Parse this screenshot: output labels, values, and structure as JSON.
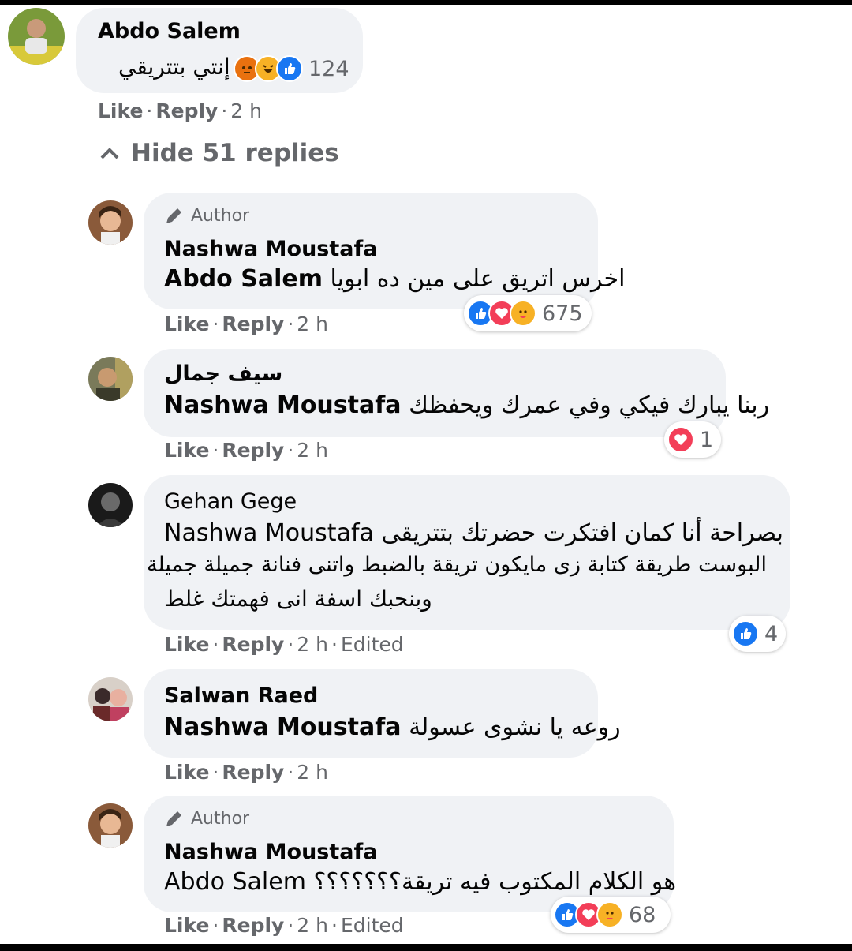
{
  "colors": {
    "like_blue": "#1877f2",
    "love_red": "#f33e58",
    "haha_yellow": "#f7b125",
    "text_grey": "#65676b",
    "bubble_bg": "#f0f2f5"
  },
  "top_comment": {
    "name": "Abdo Salem",
    "text": "إنتي بتتريقي",
    "reaction_count": "124",
    "reactions": [
      "angry-icon",
      "haha-icon",
      "like-icon"
    ],
    "like": "Like",
    "reply": "Reply",
    "time": "2 h"
  },
  "hide_replies": "Hide 51 replies",
  "replies": [
    {
      "author_badge": "Author",
      "name": "Nashwa Moustafa",
      "mention": "Abdo Salem",
      "text": "اخرس اتريق على مين ده ابويا",
      "reaction_count": "675",
      "reactions": [
        "like-icon",
        "love-icon",
        "care-icon"
      ],
      "like": "Like",
      "reply": "Reply",
      "time": "2 h"
    },
    {
      "name": "سيف جمال",
      "mention": "Nashwa Moustafa",
      "text": "ربنا يبارك فيكي وفي عمرك ويحفظك",
      "reaction_count": "1",
      "reactions": [
        "love-icon"
      ],
      "like": "Like",
      "reply": "Reply",
      "time": "2 h"
    },
    {
      "name": "Gehan Gege",
      "mention": "Nashwa Moustafa",
      "text_line1": "بصراحة أنا كمان افتكرت حضرتك بتتريقى",
      "text_line2": "البوست طريقة كتابة زى مايكون تريقة بالضبط واتنى فنانة جميلة جميلة",
      "text_line3": "وبنحبك اسفة انى فهمتك غلط",
      "reaction_count": "4",
      "reactions": [
        "like-icon"
      ],
      "like": "Like",
      "reply": "Reply",
      "time": "2 h",
      "edited": "Edited"
    },
    {
      "name": "Salwan Raed",
      "mention": "Nashwa Moustafa",
      "text": "روعه يا نشوى عسولة",
      "like": "Like",
      "reply": "Reply",
      "time": "2 h"
    },
    {
      "author_badge": "Author",
      "name": "Nashwa Moustafa",
      "mention": "Abdo Salem",
      "text": "هو الكلام المكتوب فيه تريقة؟؟؟؟؟؟؟",
      "reaction_count": "68",
      "reactions": [
        "like-icon",
        "love-icon",
        "care-icon"
      ],
      "like": "Like",
      "reply": "Reply",
      "time": "2 h",
      "edited": "Edited"
    }
  ]
}
